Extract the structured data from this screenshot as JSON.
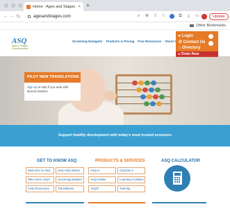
{
  "browser": {
    "tab_title": "Home - Ages and Stages",
    "tab_close": "×",
    "new_tab": "+",
    "url": "agesandstages.com",
    "update_label": "Update",
    "bookmarks_label": "Other Bookmarks"
  },
  "site": {
    "logo_text": "ASQ",
    "logo_tagline": "Ages & Stages Questionnaires",
    "nav": [
      "Screening Navigator",
      "Products & Pricing",
      "Free Resources",
      "About ASQ",
      "Training Portal"
    ],
    "quick_links": {
      "login": "Login",
      "contact": "Contact Us",
      "directory": "Directory",
      "order": "Order Now"
    },
    "promo": {
      "title": "PILOT NEW TRANSLATIONS",
      "link": "Sign up",
      "text": " to help if you work with diverse families"
    },
    "banner_text": "Support healthy development with today's most trusted screeners",
    "sections": {
      "know": {
        "title": "GET TO KNOW ASQ",
        "items": [
          "Welcome to ASQ",
          "How ASQ Works",
          "Who Uses ASQ?",
          "Screening Matters",
          "ASQ Resources",
          "Translations"
        ]
      },
      "products": {
        "title": "PRODUCTS & SERVICES",
        "items": [
          "ASQ-3",
          "ASQ:SE-2",
          "ASQ Online",
          "Learning Activities",
          "ASQ®",
          "Training"
        ]
      },
      "calculator": {
        "title": "ASQ CALCULATOR"
      }
    }
  },
  "colors": {
    "accent_orange": "#e67a26",
    "accent_blue": "#2f7fb5",
    "banner_blue": "#3aa0d2",
    "order_red": "#c8322e"
  }
}
